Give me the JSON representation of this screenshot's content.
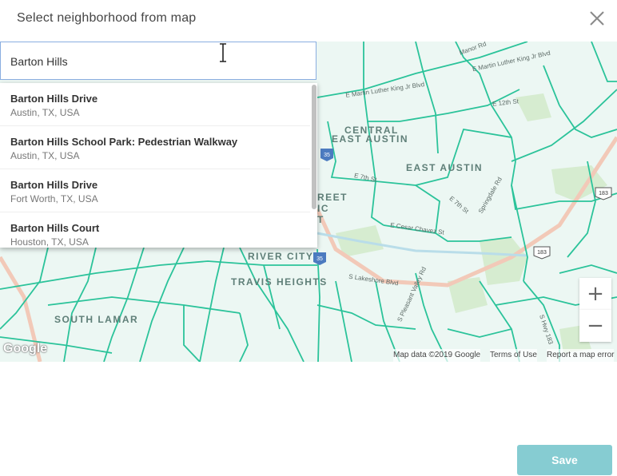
{
  "dialog": {
    "title": "Select neighborhood from map",
    "save_label": "Save"
  },
  "search": {
    "value": "Barton Hills"
  },
  "suggestions": [
    {
      "main": "Barton Hills Drive",
      "sub": "Austin, TX, USA"
    },
    {
      "main": "Barton Hills School Park: Pedestrian Walkway",
      "sub": "Austin, TX, USA"
    },
    {
      "main": "Barton Hills Drive",
      "sub": "Fort Worth, TX, USA"
    },
    {
      "main": "Barton Hills Court",
      "sub": "Houston, TX, USA"
    }
  ],
  "map": {
    "neighborhoods": {
      "central": "CENTRAL",
      "east_austin_central": "EAST AUSTIN",
      "east_austin": "EAST AUSTIN",
      "street_a": "REET",
      "street_b": "IC",
      "street_c": "T",
      "river_city": "RIVER CITY",
      "travis_heights": "TRAVIS HEIGHTS",
      "south_lamar": "SOUTH LAMAR"
    },
    "streets": {
      "mlk_1": "E Martin Luther King Jr Blvd",
      "mlk_2": "E Martin Luther King Jr Blvd",
      "st_12th": "E 12th St",
      "st_7th_a": "E 7th St",
      "st_7th_b": "E 7th St",
      "springdale": "Springdale Rd",
      "cesar_chavez": "E Cesar Chavez St",
      "lakeshore": "S Lakeshore Blvd",
      "pleasant_valley": "S Pleasant Valley Rd",
      "hwy_183": "S Hwy 183",
      "manor": "Manor Rd"
    },
    "shields": {
      "i35_a": "35",
      "i35_b": "35",
      "us183_a": "183",
      "us183_b": "183"
    },
    "zoom_in": "+",
    "zoom_out": "−",
    "logo": "Google",
    "attribution": {
      "map_data": "Map data ©2019 Google",
      "terms": "Terms of Use",
      "report": "Report a map error"
    },
    "colors": {
      "boundary": "#2bc39a",
      "background": "#ecf7f3",
      "park": "#d6ecd0"
    }
  }
}
